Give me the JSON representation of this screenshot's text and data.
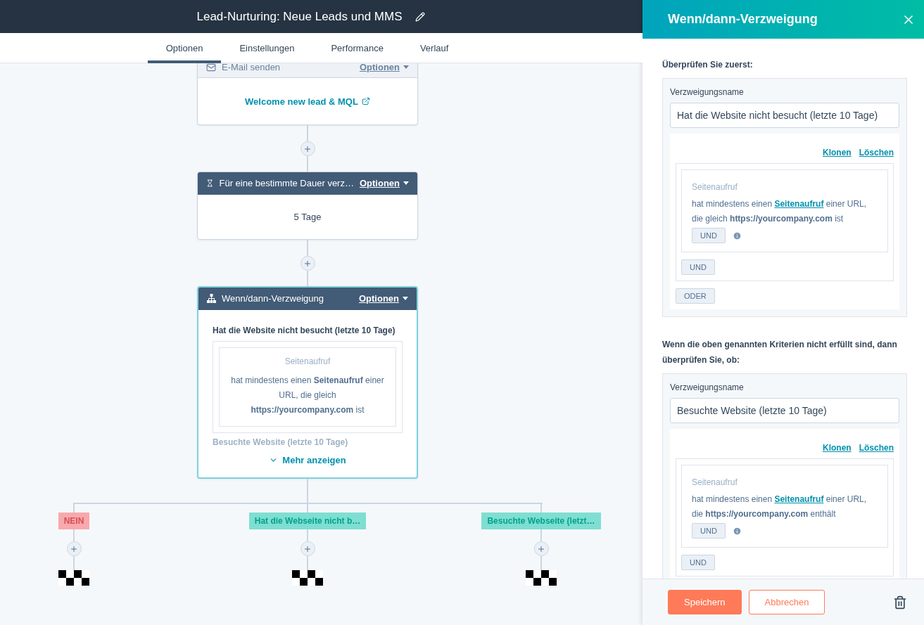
{
  "header": {
    "title": "Lead-Nurturing: Neue Leads und MMS"
  },
  "tabs": [
    {
      "label": "Optionen",
      "selected": true
    },
    {
      "label": "Einstellungen",
      "selected": false
    },
    {
      "label": "Performance",
      "selected": false
    },
    {
      "label": "Verlauf",
      "selected": false
    }
  ],
  "actions": [
    {
      "kind": "email",
      "faded": true,
      "header": "E-Mail senden",
      "options": "Optionen",
      "link": "Welcome new lead & MQL",
      "selected": false
    },
    {
      "kind": "delay",
      "faded": false,
      "header": "Für eine bestimmte Dauer verz…",
      "options": "Optionen",
      "body": "5 Tage",
      "selected": false
    },
    {
      "kind": "branch",
      "faded": false,
      "header": "Wenn/dann-Verzweigung",
      "options": "Optionen",
      "selected": true,
      "branch_title": "Hat die Website nicht besucht (letzte 10 Tage)",
      "criterion": {
        "category": "Seitenaufruf",
        "text": "hat mindestens einen **Seitenaufruf** einer URL, die gleich **https://yourcompany.com** ist"
      },
      "faded_text": "Besuchte Website (letzte 10 Tage)",
      "more": "Mehr anzeigen"
    }
  ],
  "branches": [
    {
      "kind": "none",
      "label": "NEIN"
    },
    {
      "kind": "match",
      "label": "Hat die Webseite nicht b…"
    },
    {
      "kind": "match",
      "label": "Besuchte Webseite (letzt…"
    }
  ],
  "panel": {
    "title": "Wenn/dann-Verzweigung",
    "sections": [
      {
        "heading": "Überprüfen Sie zuerst:",
        "name_label": "Verzweigungsname",
        "name_value": "Hat die Website nicht besucht (letzte 10 Tage)",
        "clone": "Klonen",
        "delete": "Löschen",
        "category": "Seitenaufruf",
        "before": "hat mindestens einen ",
        "link": "Seitenaufruf",
        "after": " einer URL, die gleich **https://yourcompany.com** ist",
        "and_inner": "UND",
        "and_outer": "UND",
        "or": "ODER"
      },
      {
        "heading": "Wenn die oben genannten Kriterien nicht erfüllt sind, dann überprüfen Sie, ob:",
        "name_label": "Verzweigungsname",
        "name_value": "Besuchte Website (letzte 10 Tage)",
        "clone": "Klonen",
        "delete": "Löschen",
        "category": "Seitenaufruf",
        "before": "hat mindestens einen ",
        "link": "Seitenaufruf",
        "after": " einer URL, die **https://yourcompany.com** enthält",
        "and_inner": "UND",
        "and_outer": "UND"
      }
    ],
    "save": "Speichern",
    "cancel": "Abbrechen"
  }
}
